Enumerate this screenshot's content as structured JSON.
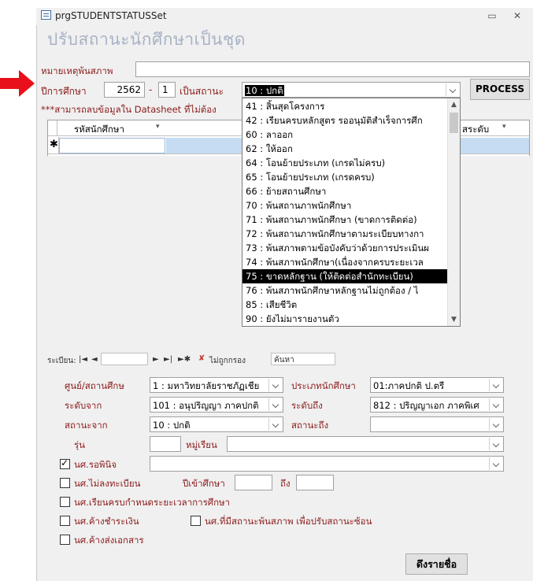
{
  "window": {
    "title": "prgSTUDENTSTATUSSet",
    "heading": "ปรับสถานะนักศึกษาเป็นชุด"
  },
  "top": {
    "remark_label": "หมายเหตุพ้นสภาพ",
    "remark_value": "",
    "year_label": "ปีการศึกษา",
    "year_value": "2562",
    "dash": "-",
    "term_value": "1",
    "status_label": "เป็นสถานะ",
    "status_value": "10 : ปกติ",
    "process_label": "PROCESS",
    "note": "***สามารถลบข้อมูลใน Datasheet ที่ไม่ต้อง"
  },
  "grid": {
    "col1": "รหัสนักศึกษา",
    "col_last": "สระดับ",
    "new_row_marker": "✱"
  },
  "navbar": {
    "record_label": "ระเบียน:",
    "first": "|◄",
    "prev": "◄",
    "next": "►",
    "last": "►|",
    "new": "►✱",
    "filter_label": "ไม่ถูกกรอง",
    "search_label": "ค้นหา"
  },
  "dropdown_list": [
    "41 : สิ้นสุดโครงการ",
    "42 : เรียนครบหลักสูตร รออนุมัติสำเร็จการศึก",
    "60 : ลาออก",
    "62 : ให้ออก",
    "64 : โอนย้ายประเภท (เกรดไม่ครบ)",
    "65 : โอนย้ายประเภท (เกรดครบ)",
    "66 : ย้ายสถานศึกษา",
    "70 : พ้นสถานภาพนักศึกษา",
    "71 : พ้นสถานภาพนักศึกษา (ขาดการติดต่อ)",
    "72 : พ้นสถานภาพนักศึกษาตามระเบียบทางกา",
    "73 : พ้นสภาพตามข้อบังคับว่าด้วยการประเมินผ",
    "74 : พ้นสภาพนักศึกษา(เนื่องจากครบระยะเวล",
    "75 : ขาดหลักฐาน (ให้ติดต่อสำนักทะเบียน)",
    "76 : พ้นสภาพนักศึกษาหลักฐานไม่ถูกต้อง / ไ",
    "85 : เสียชีวิต",
    "90 : ยังไม่มารายงานตัว"
  ],
  "dropdown_selected_index": 12,
  "filters": {
    "center_label": "ศูนย์/สถานศึกษ",
    "center_value": "1 : มหาวิทยาลัยราชภัฏเชีย",
    "type_label": "ประเภทนักศึกษา",
    "type_value": "01:ภาคปกติ ป.ตรี",
    "level_from_label": "ระดับจาก",
    "level_from_value": "101 : อนุปริญญา ภาคปกติ",
    "level_to_label": "ระดับถึง",
    "level_to_value": "812 : ปริญญาเอก ภาคพิเศ",
    "status_from_label": "สถานะจาก",
    "status_from_value": "10 : ปกติ",
    "status_to_label": "สถานะถึง",
    "status_to_value": "",
    "gen_label": "รุ่น",
    "gen_value": "",
    "group_label": "หมู่เรียน",
    "group_value": ""
  },
  "checks": {
    "pending_label": "นศ.รอพินิจ",
    "pending_checked": true,
    "pending_value": "",
    "not_registered_label": "นศ.ไม่ลงทะเบียน",
    "entry_year_label": "ปีเข้าศึกษา",
    "entry_from": "",
    "to_label": "ถึง",
    "entry_to": "",
    "completed_label": "นศ.เรียนครบกำหนดระยะเวลาการศึกษา",
    "owing_label": "นศ.ค้างชำระเงิน",
    "status_dup_label": "นศ.ที่มีสถานะพ้นสภาพ เพื่อปรับสถานะซ้อน",
    "documents_label": "นศ.ค้างส่งเอกสาร"
  },
  "fetch_button": "ดึงรายชื่อ",
  "colors": {
    "accent_label": "#8b1a1a",
    "heading": "#a8b2c4",
    "selection": "#000000",
    "arrow": "#e8101a"
  }
}
